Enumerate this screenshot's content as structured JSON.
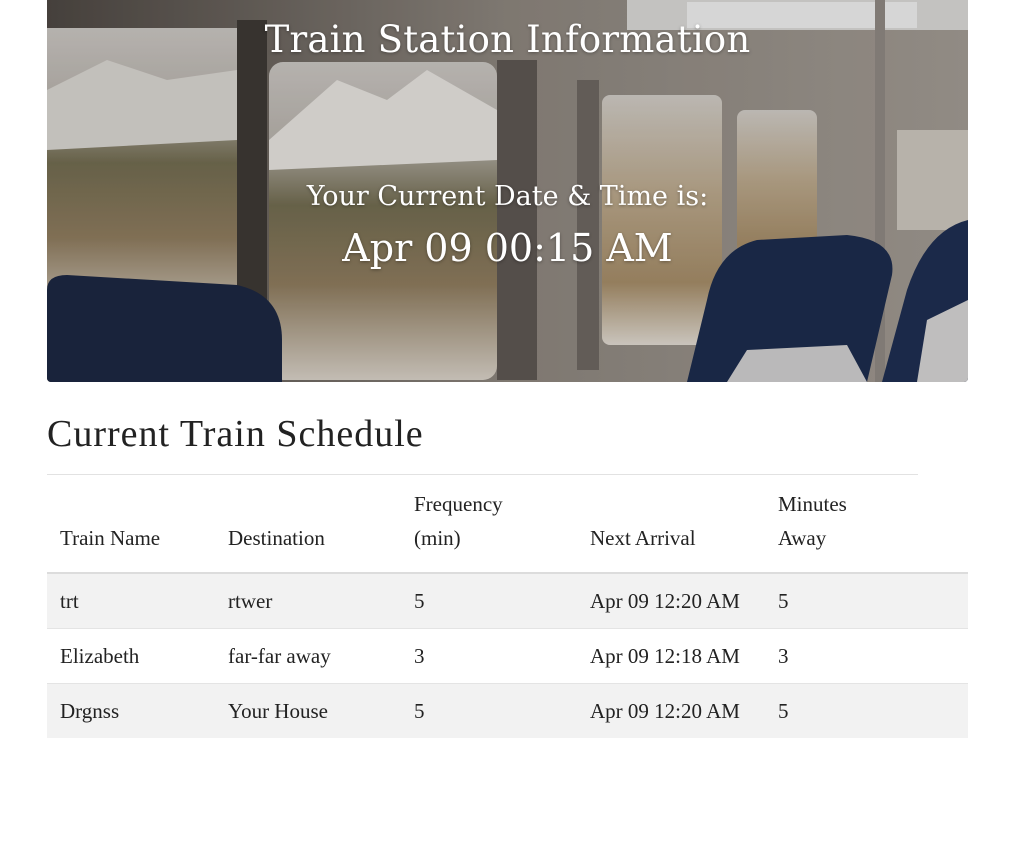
{
  "hero": {
    "title": "Train Station Information",
    "subtitle": "Your Current Date & Time is:",
    "current_time": "Apr 09 00:15 AM"
  },
  "schedule": {
    "heading": "Current Train Schedule",
    "columns": {
      "name": "Train Name",
      "destination": "Destination",
      "frequency_line1": "Frequency",
      "frequency_line2": "(min)",
      "next_arrival": "Next Arrival",
      "minutes_line1": "Minutes",
      "minutes_line2": "Away"
    },
    "rows": [
      {
        "name": "trt",
        "destination": "rtwer",
        "frequency": "5",
        "next_arrival": "Apr 09 12:20 AM",
        "minutes_away": "5"
      },
      {
        "name": "Elizabeth",
        "destination": "far-far away",
        "frequency": "3",
        "next_arrival": "Apr 09 12:18 AM",
        "minutes_away": "3"
      },
      {
        "name": "Drgnss",
        "destination": "Your House",
        "frequency": "5",
        "next_arrival": "Apr 09 12:20 AM",
        "minutes_away": "5"
      }
    ]
  }
}
